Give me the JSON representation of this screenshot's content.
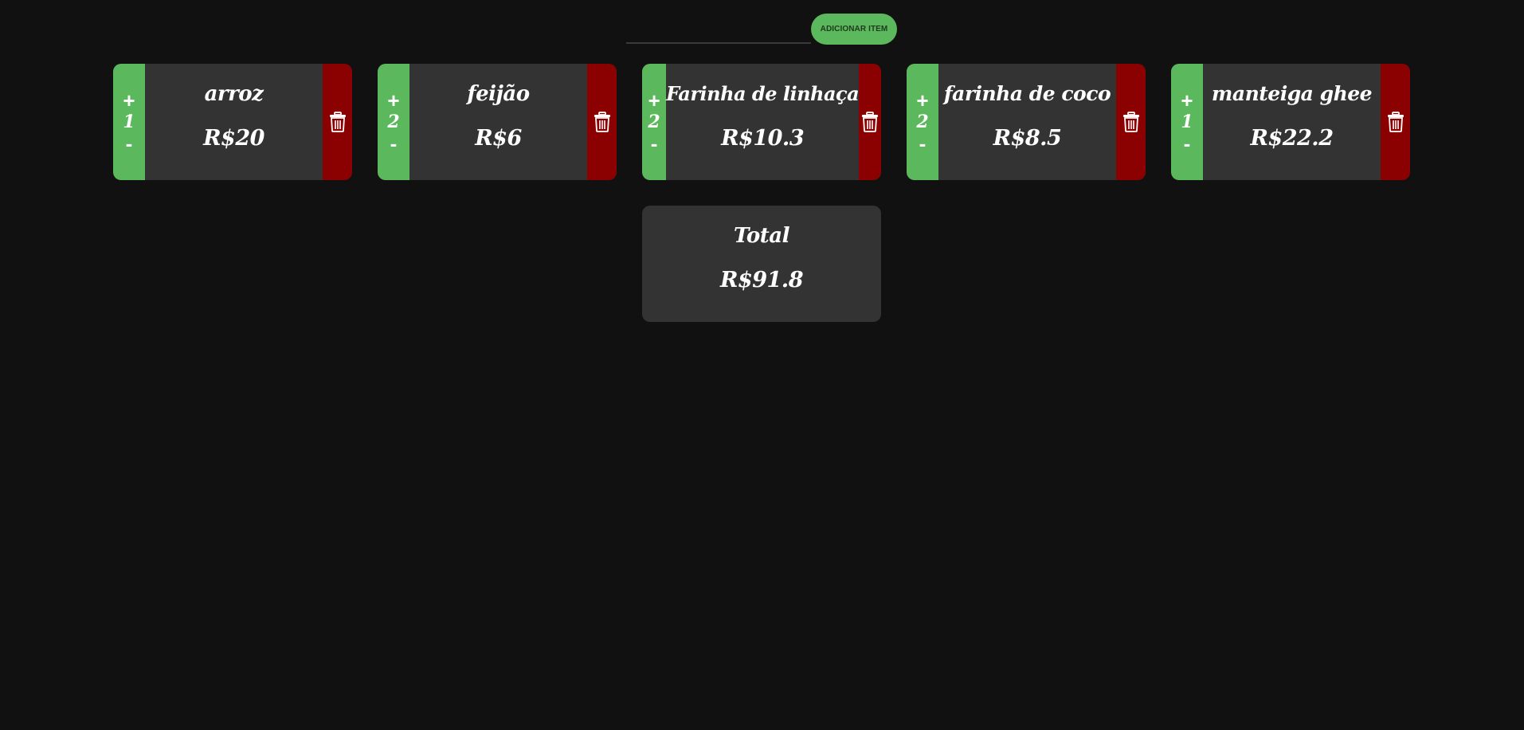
{
  "add_form": {
    "input_value": "",
    "input_placeholder": "",
    "button_label": "ADICIONAR ITEM"
  },
  "controls": {
    "plus_label": "+",
    "minus_label": "-",
    "delete_icon": "trash-icon"
  },
  "items": [
    {
      "name": "arroz",
      "quantity": "1",
      "price": "R$20"
    },
    {
      "name": "feijão",
      "quantity": "2",
      "price": "R$6"
    },
    {
      "name": "Farinha de linhaça",
      "quantity": "2",
      "price": "R$10.3"
    },
    {
      "name": "farinha de coco",
      "quantity": "2",
      "price": "R$8.5"
    },
    {
      "name": "manteiga ghee",
      "quantity": "1",
      "price": "R$22.2"
    }
  ],
  "total": {
    "label": "Total",
    "value": "R$91.8"
  },
  "colors": {
    "background": "#111111",
    "card": "#333333",
    "accent_green": "#5cb85c",
    "delete_red": "#8b0000",
    "text": "#ffffff"
  }
}
